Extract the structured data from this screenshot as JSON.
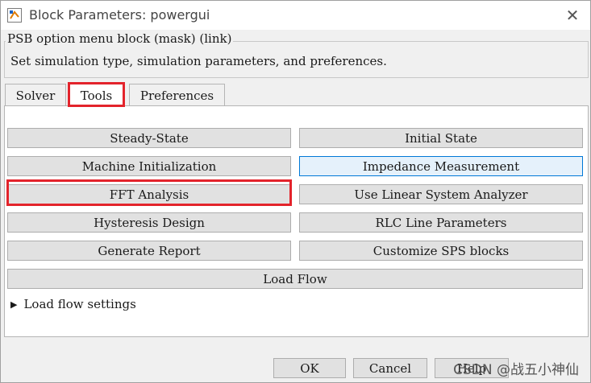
{
  "window": {
    "title": "Block Parameters: powergui",
    "close_symbol": "✕"
  },
  "mask": {
    "legend": "PSB option menu block (mask) (link)",
    "description": "Set simulation type, simulation parameters, and preferences."
  },
  "tabs": [
    {
      "label": "Solver"
    },
    {
      "label": "Tools"
    },
    {
      "label": "Preferences"
    }
  ],
  "tools": {
    "steady_state": "Steady-State",
    "initial_state": "Initial State",
    "machine_init": "Machine Initialization",
    "impedance": "Impedance Measurement",
    "fft": "FFT Analysis",
    "linear_system": "Use Linear System Analyzer",
    "hysteresis": "Hysteresis Design",
    "rlc": "RLC Line Parameters",
    "report": "Generate Report",
    "customize": "Customize SPS blocks",
    "load_flow": "Load Flow"
  },
  "load_flow_settings": {
    "label": "Load flow settings",
    "caret": "▶"
  },
  "footer": {
    "ok": "OK",
    "cancel": "Cancel",
    "help": "Help"
  },
  "watermark": "CSDN @战五小神仙"
}
